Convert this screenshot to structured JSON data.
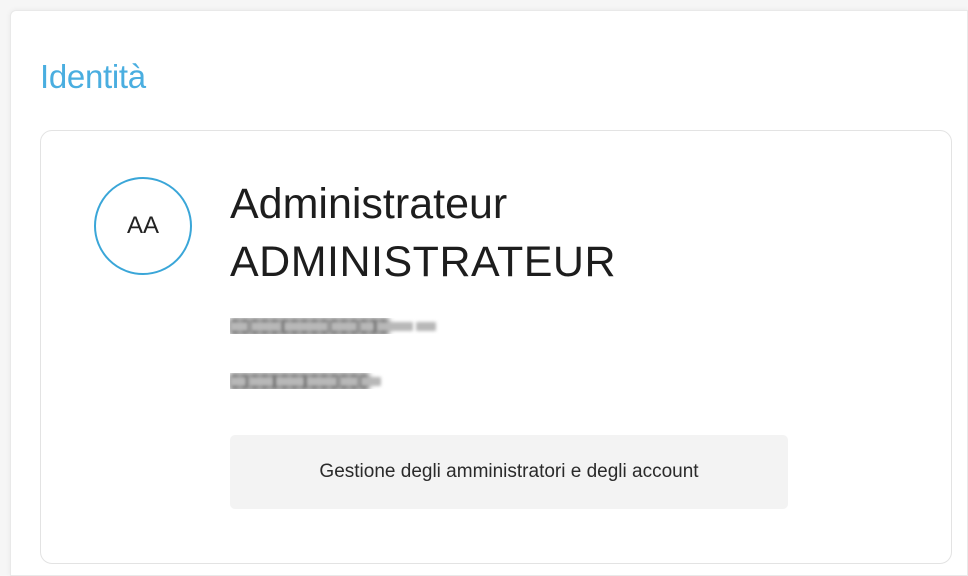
{
  "section": {
    "title": "Identità"
  },
  "profile": {
    "initials": "AA",
    "first_name": "Administrateur",
    "last_name": "ADMINISTRATEUR",
    "email_redacted": "████████████████",
    "phone_redacted": "██████████████"
  },
  "actions": {
    "manage_label": "Gestione degli amministratori e degli account"
  }
}
